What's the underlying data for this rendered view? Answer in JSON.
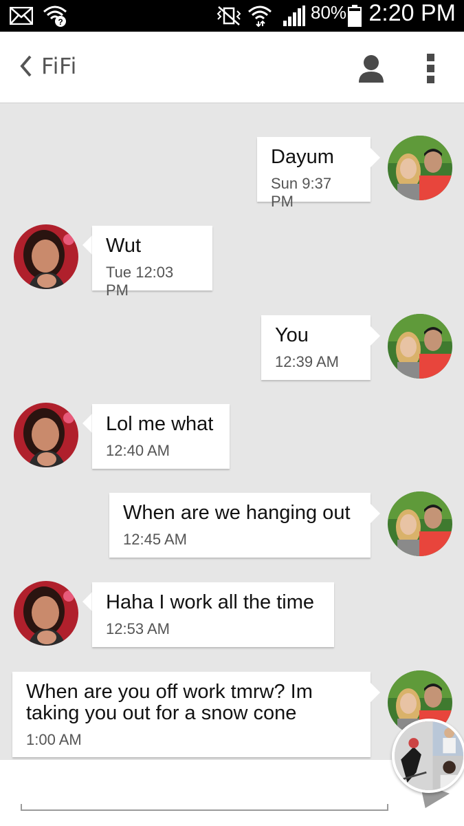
{
  "status_bar": {
    "battery_percent": "80%",
    "time": "2:20 PM"
  },
  "header": {
    "title": "FiFi"
  },
  "messages": [
    {
      "from": "me",
      "text": "Dayum",
      "time": "Sun 9:37 PM"
    },
    {
      "from": "them",
      "text": "Wut",
      "time": "Tue 12:03 PM"
    },
    {
      "from": "me",
      "text": "You",
      "time": "12:39 AM"
    },
    {
      "from": "them",
      "text": "Lol me what",
      "time": "12:40 AM"
    },
    {
      "from": "me",
      "text": "When are we hanging out",
      "time": "12:45 AM"
    },
    {
      "from": "them",
      "text": "Haha I work all the time",
      "time": "12:53 AM"
    },
    {
      "from": "me",
      "text": "When are you off work tmrw? Im taking you out for a snow cone",
      "time": "1:00 AM"
    }
  ],
  "colors": {
    "background": "#e6e6e6",
    "bubble": "#ffffff",
    "status_bar": "#000000"
  }
}
